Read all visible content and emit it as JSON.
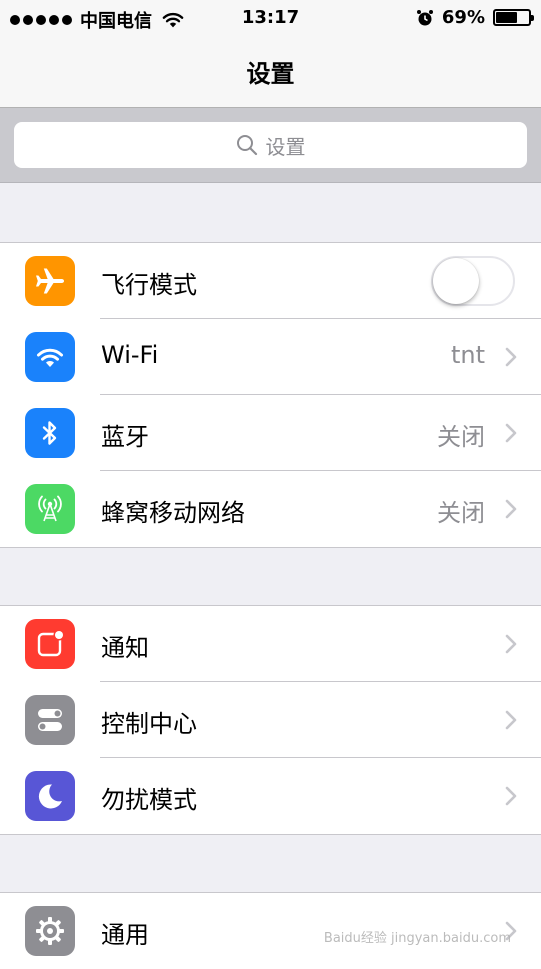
{
  "status_bar": {
    "carrier": "中国电信",
    "time": "13:17",
    "battery_percent_text": "69%",
    "battery_level": 0.69
  },
  "nav": {
    "title": "设置"
  },
  "search": {
    "placeholder": "设置"
  },
  "groups": [
    {
      "rows": [
        {
          "label": "飞行模式",
          "icon": "airplane-icon",
          "icon_color": "#ff9500",
          "control": "toggle",
          "toggle_on": false
        },
        {
          "label": "Wi-Fi",
          "icon": "wifi-icon",
          "icon_color": "#1a82fb",
          "value": "tnt"
        },
        {
          "label": "蓝牙",
          "icon": "bluetooth-icon",
          "icon_color": "#1a82fb",
          "value": "关闭"
        },
        {
          "label": "蜂窝移动网络",
          "icon": "cellular-antenna-icon",
          "icon_color": "#4cd964",
          "value": "关闭"
        }
      ]
    },
    {
      "rows": [
        {
          "label": "通知",
          "icon": "notification-icon",
          "icon_color": "#ff3b30"
        },
        {
          "label": "控制中心",
          "icon": "control-center-icon",
          "icon_color": "#8e8e93"
        },
        {
          "label": "勿扰模式",
          "icon": "moon-icon",
          "icon_color": "#5856d6"
        }
      ]
    },
    {
      "rows": [
        {
          "label": "通用",
          "icon": "gear-icon",
          "icon_color": "#8e8e93"
        }
      ]
    }
  ],
  "watermark": "Baidu经验 jingyan.baidu.com"
}
